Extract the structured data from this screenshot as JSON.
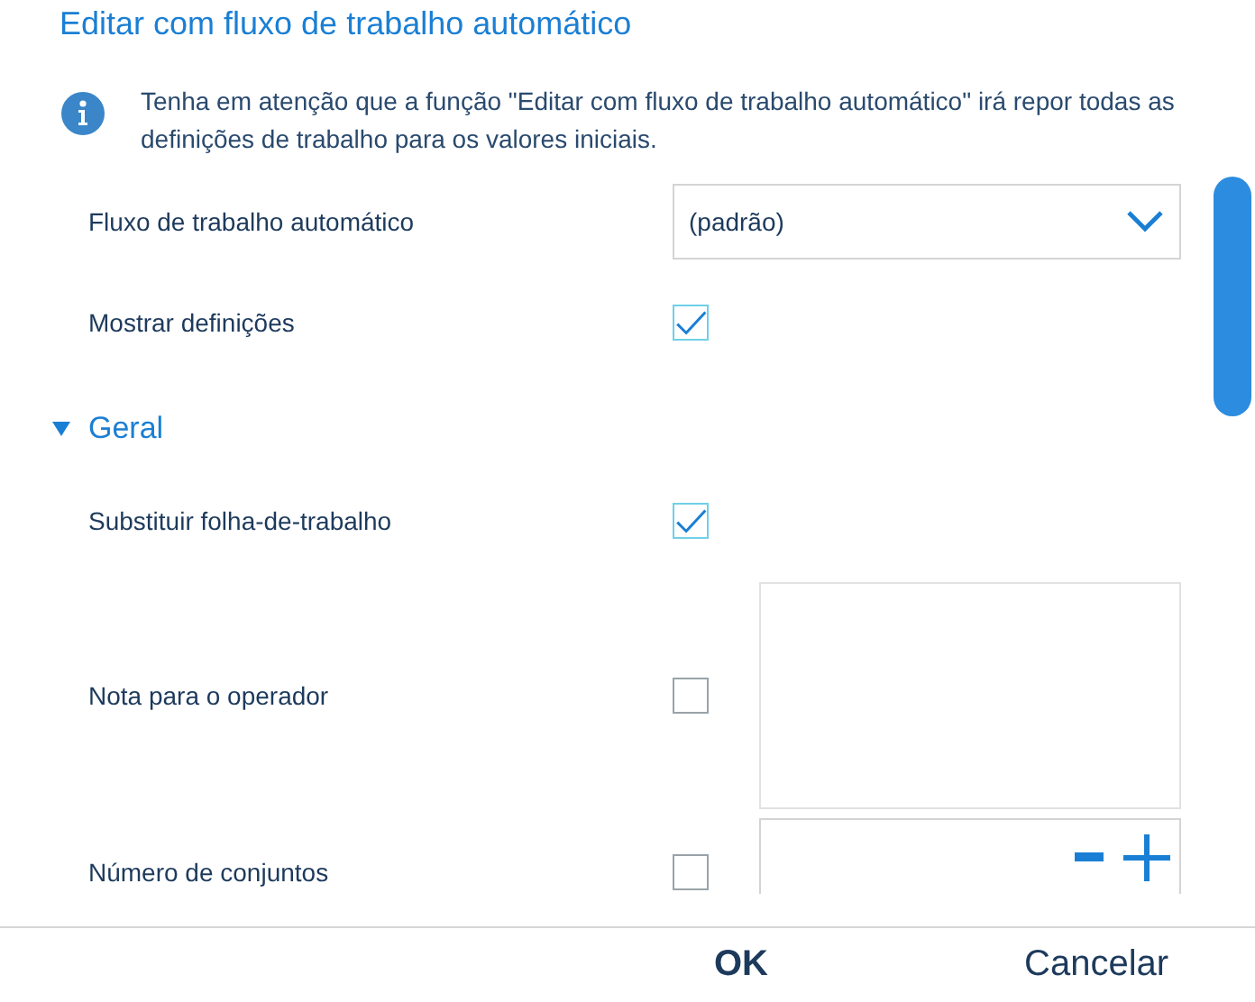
{
  "title": "Editar com fluxo de trabalho automático",
  "notice": "Tenha em atenção que a função \"Editar com fluxo de trabalho automático\" irá repor todas as definições de trabalho para os valores iniciais.",
  "top_rows": [
    {
      "kind": "dropdown",
      "label": "Fluxo de trabalho automático",
      "value": "(padrão)"
    },
    {
      "kind": "checkbox",
      "label": "Mostrar definições",
      "checked": true
    }
  ],
  "section": {
    "title": "Geral",
    "expanded": true,
    "rows": [
      {
        "kind": "checkbox",
        "label": "Substituir folha-de-trabalho",
        "checked": true
      },
      {
        "kind": "textarea",
        "label": "Nota para o operador",
        "checked": false
      },
      {
        "kind": "stepper",
        "label": "Número de conjuntos",
        "checked": false
      }
    ]
  },
  "buttons": [
    {
      "label": "OK",
      "primary": true
    },
    {
      "label": "Cancelar",
      "primary": false
    }
  ]
}
